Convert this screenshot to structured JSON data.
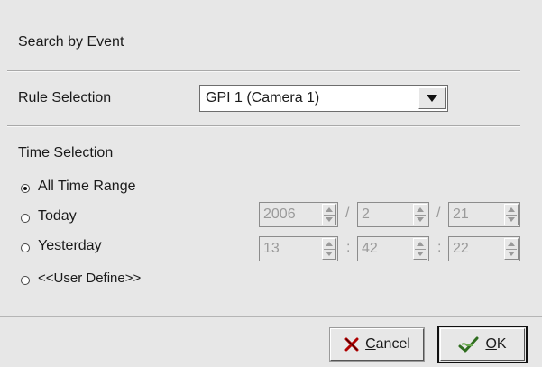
{
  "dialog": {
    "title": "Search by Event",
    "rule_selection_label": "Rule Selection",
    "rule_selection_value": "GPI 1 (Camera 1)",
    "time_selection_label": "Time Selection",
    "options": [
      {
        "label": "All Time Range",
        "selected": true
      },
      {
        "label": "Today",
        "selected": false
      },
      {
        "label": "Yesterday",
        "selected": false
      },
      {
        "label": "<<User Define>>",
        "selected": false
      }
    ],
    "date": {
      "year": "2006",
      "month": "2",
      "day": "21",
      "sep": "/"
    },
    "time": {
      "hour": "13",
      "minute": "42",
      "second": "22",
      "sep": ":"
    },
    "buttons": {
      "cancel_prefix": "",
      "cancel_mnemonic": "C",
      "cancel_rest": "ancel",
      "ok_mnemonic": "O",
      "ok_rest": "K"
    }
  },
  "icons": {
    "cancel": "x-icon",
    "ok": "checkmark-hand-icon",
    "combo": "chevron-down-icon",
    "spin": "spin-arrows-icon"
  },
  "colors": {
    "background": "#e7e7e7",
    "disabled_text": "#9a9a9a"
  }
}
